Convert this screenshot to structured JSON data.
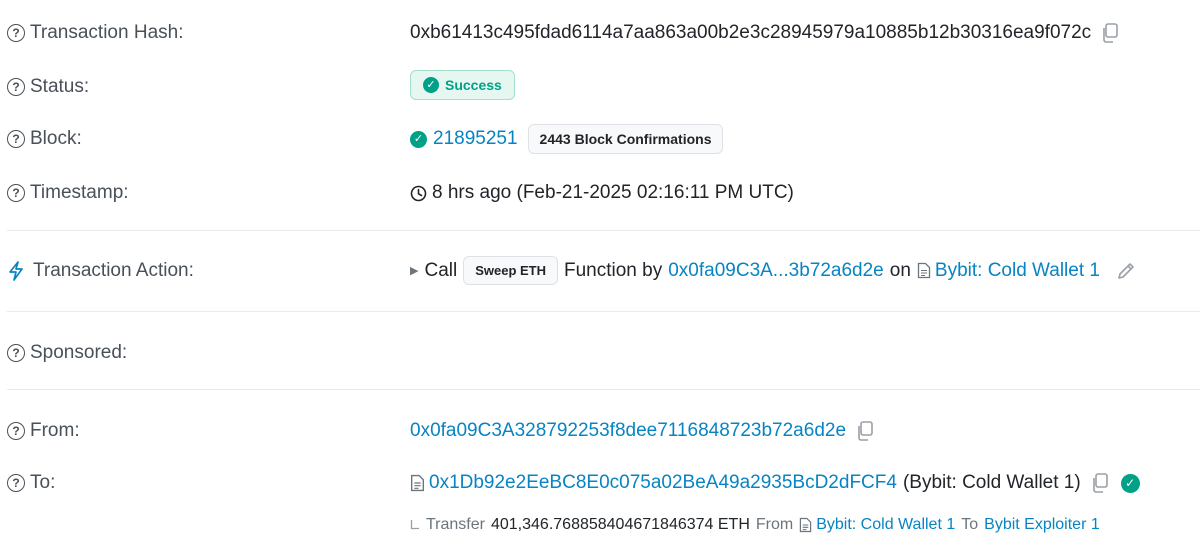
{
  "rows": {
    "tx_hash": {
      "label": "Transaction Hash:",
      "value": "0xb61413c495fdad6114a7aa863a00b2e3c28945979a10885b12b30316ea9f072c"
    },
    "status": {
      "label": "Status:",
      "value": "Success"
    },
    "block": {
      "label": "Block:",
      "value": "21895251",
      "confirmations": "2443 Block Confirmations"
    },
    "timestamp": {
      "label": "Timestamp:",
      "value": "8 hrs ago (Feb-21-2025 02:16:11 PM UTC)"
    },
    "action": {
      "label": "Transaction Action:",
      "call": "Call",
      "function_name": "Sweep ETH",
      "function_by": "Function by",
      "caller": "0x0fa09C3A...3b72a6d2e",
      "on": "on",
      "contract": "Bybit: Cold Wallet 1"
    },
    "sponsored": {
      "label": "Sponsored:"
    },
    "from": {
      "label": "From:",
      "value": "0x0fa09C3A328792253f8dee7116848723b72a6d2e"
    },
    "to": {
      "label": "To:",
      "value": "0x1Db92e2EeBC8E0c075a02BeA49a2935BcD2dFCF4",
      "name": "(Bybit: Cold Wallet 1)",
      "transfer": {
        "label": "Transfer",
        "amount": "401,346.768858404671846374 ETH",
        "from_label": "From",
        "from": "Bybit: Cold Wallet 1",
        "to_label": "To",
        "to": "Bybit Exploiter 1"
      }
    }
  },
  "colors": {
    "link": "#0784c3",
    "success": "#00a186",
    "label": "#495057"
  }
}
